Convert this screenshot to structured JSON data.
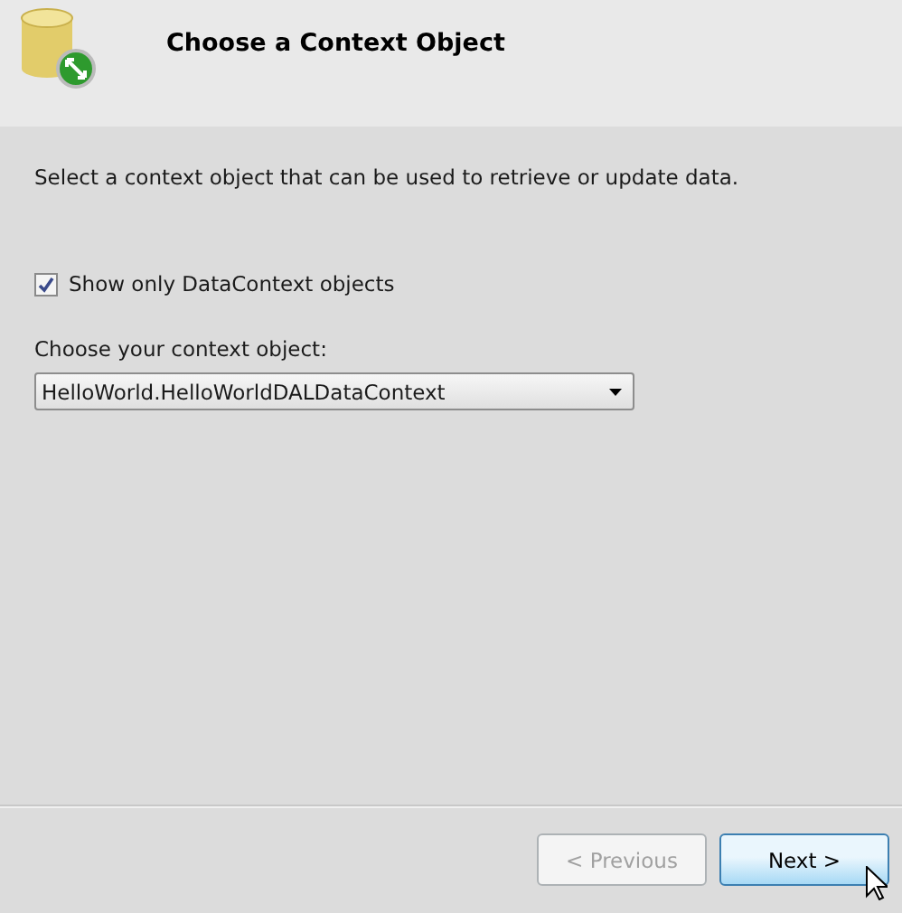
{
  "header": {
    "title": "Choose a Context Object"
  },
  "description": "Select a context object that can be used to retrieve or update data.",
  "filter": {
    "label": "Show only DataContext objects",
    "checked": true
  },
  "context_select": {
    "label": "Choose your context object:",
    "value": "HelloWorld.HelloWorldDALDataContext"
  },
  "buttons": [
    {
      "label": "< Previous",
      "disabled": true,
      "hovered": false
    },
    {
      "label": "Next >",
      "disabled": false,
      "hovered": true
    }
  ]
}
